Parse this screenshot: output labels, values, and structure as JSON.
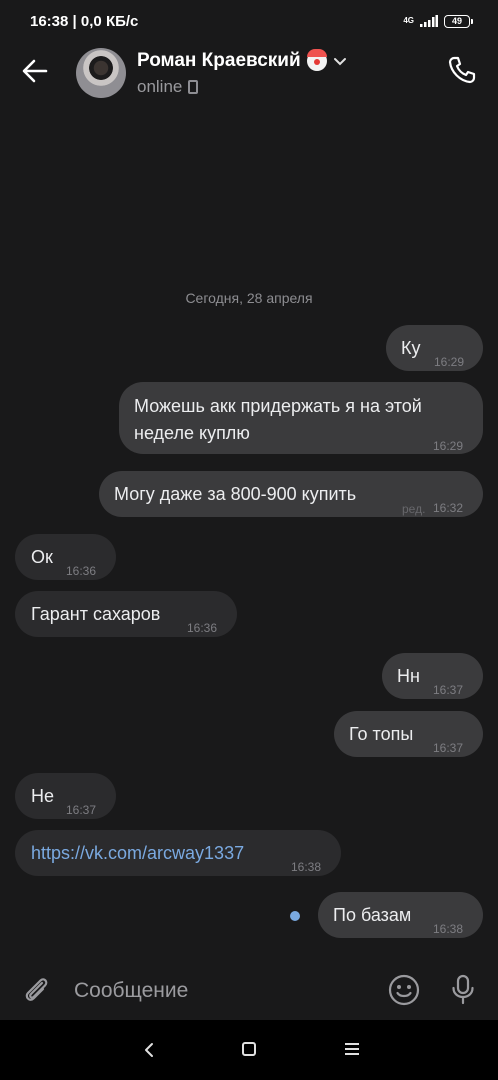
{
  "status_bar": {
    "time": "16:38",
    "network_speed": "0,0 КБ/с",
    "net_type": "4G",
    "battery": "49"
  },
  "header": {
    "contact_name": "Роман Краевский",
    "status": "online"
  },
  "chat": {
    "date_divider": "Сегодня, 28 апреля",
    "messages": [
      {
        "direction": "out",
        "text": "Ку",
        "time": "16:29"
      },
      {
        "direction": "out",
        "text_line1": "Можешь акк придержать я на этой",
        "text_line2": "неделе куплю",
        "time": "16:29"
      },
      {
        "direction": "out",
        "text": "Могу даже за 800-900 купить",
        "edited": "ред.",
        "time": "16:32"
      },
      {
        "direction": "in",
        "text": "Ок",
        "time": "16:36"
      },
      {
        "direction": "in",
        "text": "Гарант сахаров",
        "time": "16:36"
      },
      {
        "direction": "out",
        "text": "Нн",
        "time": "16:37"
      },
      {
        "direction": "out",
        "text": "Го топы",
        "time": "16:37"
      },
      {
        "direction": "in",
        "text": "Не",
        "time": "16:37"
      },
      {
        "direction": "in",
        "text": "https://vk.com/arcway1337",
        "time": "16:38"
      },
      {
        "direction": "out",
        "text": "По базам",
        "time": "16:38"
      }
    ]
  },
  "composer": {
    "placeholder": "Сообщение"
  },
  "colors": {
    "background": "#19191a",
    "outgoing_bubble": "#3b3b3d",
    "incoming_bubble": "#2b2b2d",
    "link": "#7aa9e0"
  }
}
